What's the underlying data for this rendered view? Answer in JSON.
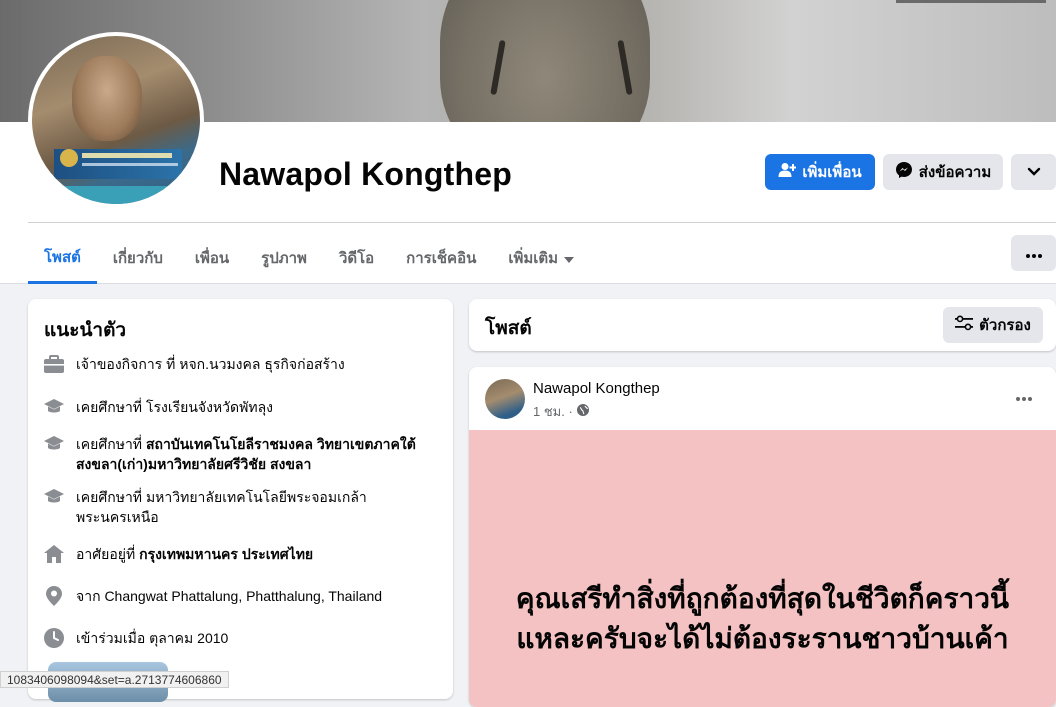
{
  "profile": {
    "name": "Nawapol Kongthep"
  },
  "actions": {
    "add_friend": "เพิ่มเพื่อน",
    "message": "ส่งข้อความ"
  },
  "tabs": [
    {
      "label": "โพสต์"
    },
    {
      "label": "เกี่ยวกับ"
    },
    {
      "label": "เพื่อน"
    },
    {
      "label": "รูปภาพ"
    },
    {
      "label": "วิดีโอ"
    },
    {
      "label": "การเช็คอิน"
    },
    {
      "label": "เพิ่มเติม"
    }
  ],
  "intro": {
    "title": "แนะนำตัว",
    "items": [
      {
        "icon": "briefcase-icon",
        "prefix": "เจ้าของกิจการ ที่ ",
        "bold": "",
        "rest": "หจก.นวมงคล ธุรกิจก่อสร้าง"
      },
      {
        "icon": "graduation-cap-icon",
        "prefix": "เคยศึกษาที่ ",
        "bold": "",
        "rest": "โรงเรียนจังหวัดพัทลุง"
      },
      {
        "icon": "graduation-cap-icon",
        "prefix": "เคยศึกษาที่ ",
        "bold": "สถาบันเทคโนโยลีราชมงคล วิทยาเขตภาคใต้ สงขลา(เก่า)มหาวิทยาลัยศรีวิชัย สงขลา",
        "rest": ""
      },
      {
        "icon": "graduation-cap-icon",
        "prefix": "เคยศึกษาที่ ",
        "bold": "",
        "rest": "มหาวิทยาลัยเทคโนโลยีพระจอมเกล้าพระนครเหนือ"
      },
      {
        "icon": "home-icon",
        "prefix": "อาศัยอยู่ที่ ",
        "bold": "กรุงเทพมหานคร ประเทศไทย",
        "rest": ""
      },
      {
        "icon": "location-pin-icon",
        "prefix": "จาก ",
        "bold": "",
        "rest": "Changwat Phattalung, Phatthalung, Thailand"
      },
      {
        "icon": "clock-icon",
        "prefix": "เข้าร่วมเมื่อ ",
        "bold": "",
        "rest": "ตุลาคม 2010"
      }
    ]
  },
  "posts": {
    "title": "โพสต์",
    "filter_label": "ตัวกรอง",
    "items": [
      {
        "author": "Nawapol Kongthep",
        "time": "1 ชม. ·",
        "text": "คุณเสรีทำสิ่งที่ถูกต้องที่สุดในชีวิตก็คราวนี้แหละครับจะได้ไม่ต้องระรานชาวบ้านเค้า",
        "bg_color": "#f4c2c2"
      }
    ]
  },
  "status_url": "1083406098094&set=a.2713774606860",
  "colors": {
    "accent": "#1b74e4",
    "secondary_button": "#e4e6eb",
    "page_bg": "#f0f2f5"
  }
}
